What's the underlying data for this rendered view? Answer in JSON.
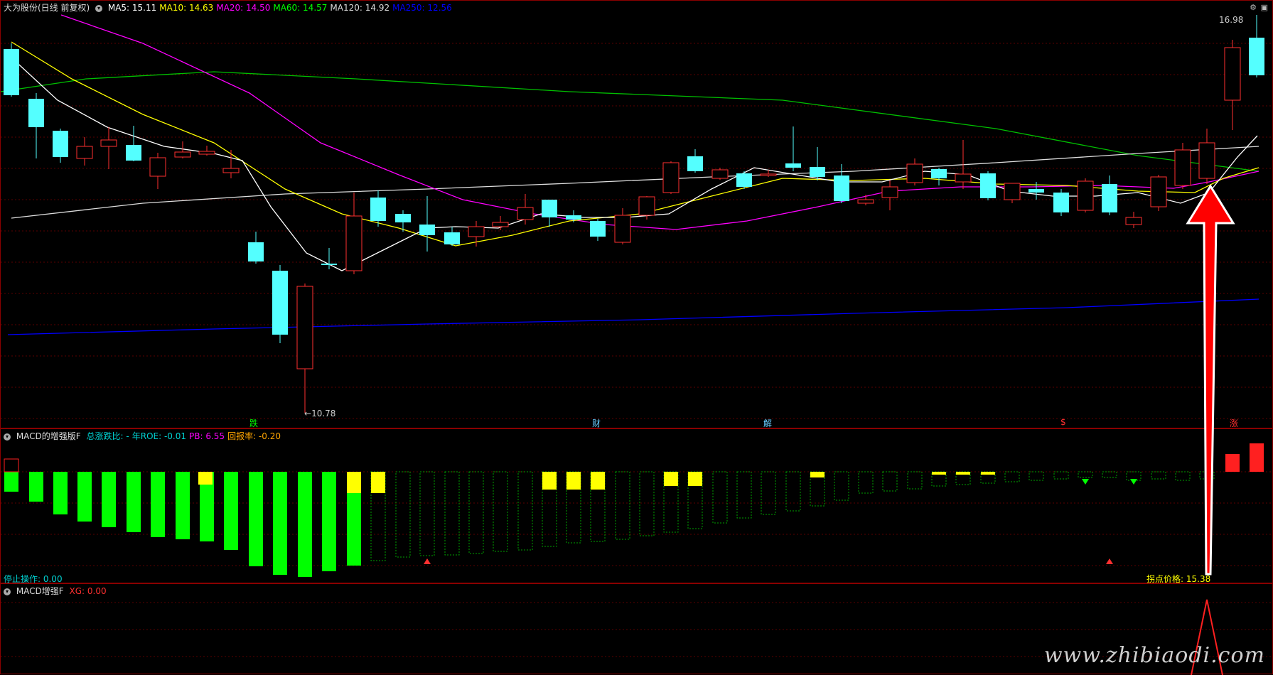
{
  "main": {
    "title": "大为股份(日线 前复权)",
    "ma": [
      {
        "label": "MA5: 15.11",
        "color": "#ffffff"
      },
      {
        "label": "MA10: 14.63",
        "color": "#ffff00"
      },
      {
        "label": "MA20: 14.50",
        "color": "#ff00ff"
      },
      {
        "label": "MA60: 14.57",
        "color": "#00ff00"
      },
      {
        "label": "MA120: 14.92",
        "color": "#dddddd"
      },
      {
        "label": "MA250: 12.56",
        "color": "#0000ff"
      }
    ],
    "high_label": "16.98",
    "low_label": "10.78",
    "event_markers": [
      {
        "text": "跌",
        "color": "#00ff00"
      },
      {
        "text": "财",
        "color": "#6cf"
      },
      {
        "text": "解",
        "color": "#6cf"
      },
      {
        "text": "$",
        "color": "#ff3030"
      },
      {
        "text": "涨",
        "color": "#ff3030"
      }
    ]
  },
  "macd": {
    "title": "MACD的增强版F",
    "fields": [
      {
        "label": "总涨跌比: -",
        "color": "#00d0d0"
      },
      {
        "label": "年ROE: -0.01",
        "color": "#00d0d0"
      },
      {
        "label": "PB: 6.55",
        "color": "#ff00ff"
      },
      {
        "label": "回报率: -0.20",
        "color": "#ffa500"
      }
    ],
    "stop_label": "停止操作: 0.00",
    "turn_label": "拐点价格: 15.38"
  },
  "macd2": {
    "title": "MACD增强F",
    "xg": "XG: 0.00"
  },
  "watermark": "www.zhibiaodi.com",
  "colors": {
    "up": "#ff3030",
    "down": "#54ffff",
    "border": "#8a0000"
  }
}
